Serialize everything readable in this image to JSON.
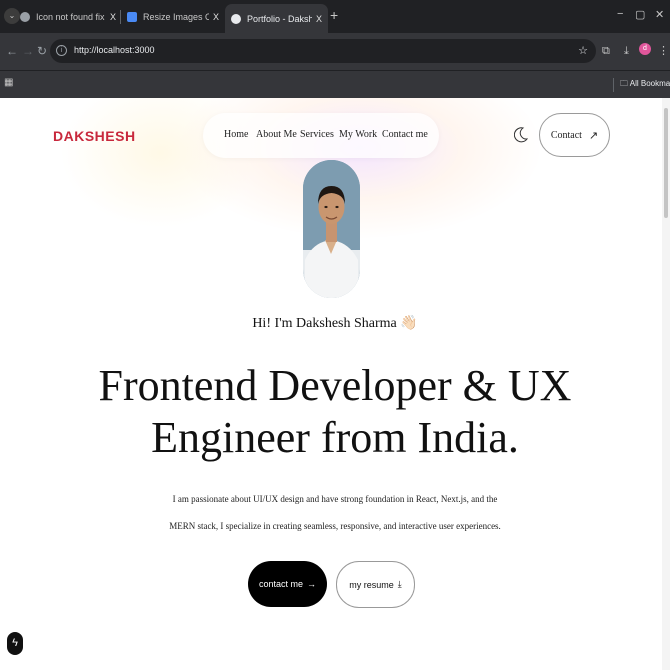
{
  "browser": {
    "tabs": [
      {
        "title": "Icon not found fix",
        "close": "X",
        "favicon_color": "#9aa0a6",
        "active": false
      },
      {
        "title": "Resize Images Online - Resize",
        "close": "X",
        "favicon_color": "#4a8af4",
        "active": false
      },
      {
        "title": "Portfolio - Dakshesh",
        "close": "X",
        "favicon_color": "#e8eaed",
        "active": true
      }
    ],
    "new_tab": "+",
    "url": "http://localhost:3000",
    "bookmarks_label": "All Bookmarks",
    "profile_initial": "d",
    "window_controls": {
      "minimize": "−",
      "restore": "▢",
      "close": "✕"
    }
  },
  "site": {
    "logo": "DAKSHESH",
    "nav": [
      "Home",
      "About Me",
      "Services",
      "My Work",
      "Contact me"
    ],
    "contact_button": "Contact",
    "greeting": "Hi! I'm Dakshesh Sharma 👋🏻",
    "headline_line1": "Frontend Developer & UX",
    "headline_line2": "Engineer from India.",
    "description_line1": "I am passionate about UI/UX design and have strong foundation in React, Next.js, and the",
    "description_line2": "MERN stack, I specialize in creating seamless, responsive, and interactive user experiences.",
    "cta_primary": "contact me",
    "cta_secondary": "my resume",
    "colors": {
      "logo": "#c8283c",
      "primary_button": "#000000"
    }
  }
}
